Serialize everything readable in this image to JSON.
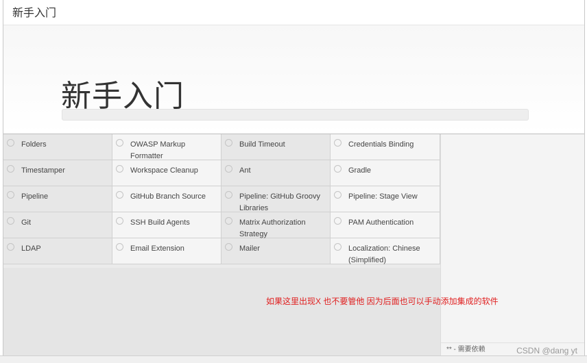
{
  "page": {
    "title": "新手入门"
  },
  "hero": {
    "heading": "新手入门",
    "progress_fraction": 0.0
  },
  "plugins": [
    "Folders",
    "OWASP Markup Formatter",
    "Build Timeout",
    "Credentials Binding",
    "Timestamper",
    "Workspace Cleanup",
    "Ant",
    "Gradle",
    "Pipeline",
    "GitHub Branch Source",
    "Pipeline: GitHub Groovy Libraries",
    "Pipeline: Stage View",
    "Git",
    "SSH Build Agents",
    "Matrix Authorization Strategy",
    "PAM Authentication",
    "LDAP",
    "Email Extension",
    "Mailer",
    "Localization: Chinese (Simplified)"
  ],
  "sidebar": {
    "legend": "** - 需要依赖"
  },
  "annotation": {
    "text": "如果这里出现X 也不要管他 因为后面也可以手动添加集成的软件",
    "color": "#e02020"
  },
  "watermark": "CSDN @dang yt"
}
